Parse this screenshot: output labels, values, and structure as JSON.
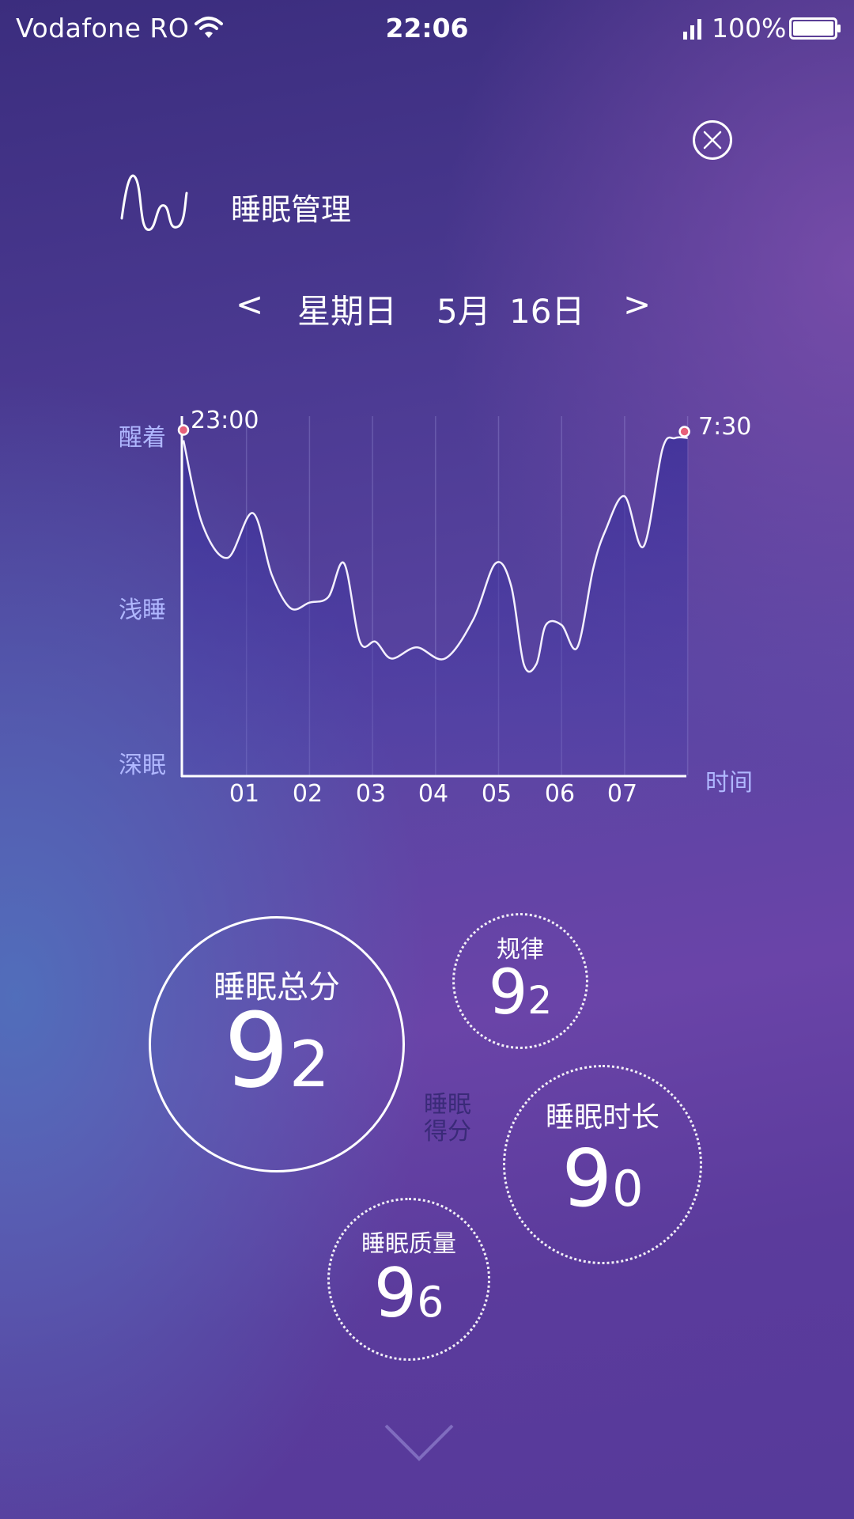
{
  "status_bar": {
    "carrier": "Vodafone RO",
    "time": "22:06",
    "battery": "100%",
    "battery_level": 1.0,
    "icons": [
      "wifi-icon",
      "signal-icon",
      "battery-icon"
    ]
  },
  "header": {
    "title": "睡眠管理",
    "icons": [
      "sleep-wave-logo-icon",
      "close-icon"
    ]
  },
  "date_nav": {
    "prev_label": "<",
    "weekday": "星期日",
    "month": "5月",
    "day": "16日",
    "next_label": ">"
  },
  "chart_data": {
    "type": "area",
    "y_levels": [
      "醒着",
      "浅睡",
      "深眠"
    ],
    "x_label": "时间",
    "x_ticks": [
      "01",
      "02",
      "03",
      "04",
      "05",
      "06",
      "07"
    ],
    "start_time": "23:00",
    "end_time": "7:30",
    "grid": true,
    "series": [
      {
        "x": [
          0,
          0.3,
          0.7,
          1.1,
          1.4,
          1.7,
          2.0,
          2.3,
          2.55,
          2.8,
          3.05,
          3.3,
          3.7,
          4.15,
          4.6,
          4.95,
          5.2,
          5.4,
          5.6,
          5.75,
          6.0,
          6.25,
          6.5,
          6.7,
          7.0,
          7.3,
          7.6,
          7.8,
          8.0
        ],
        "y": [
          3.0,
          2.25,
          1.95,
          2.35,
          1.8,
          1.5,
          1.55,
          1.6,
          1.9,
          1.2,
          1.2,
          1.05,
          1.15,
          1.05,
          1.4,
          1.9,
          1.7,
          1.0,
          1.0,
          1.35,
          1.35,
          1.15,
          1.85,
          2.2,
          2.5,
          2.05,
          2.92,
          3.02,
          3.02
        ]
      }
    ],
    "y_range": [
      0,
      3
    ]
  },
  "scores": {
    "caption": "睡眠得分",
    "total": {
      "label": "睡眠总分",
      "tens": "9",
      "ones": "2"
    },
    "regularity": {
      "label": "规律",
      "tens": "9",
      "ones": "2"
    },
    "duration": {
      "label": "睡眠时长",
      "tens": "9",
      "ones": "0"
    },
    "quality": {
      "label": "睡眠质量",
      "tens": "9",
      "ones": "6"
    }
  },
  "footer": {
    "icons": [
      "chevron-down-icon"
    ]
  },
  "colors": {
    "accent_point": "#e8607a",
    "axis_label": "#b0b7ff",
    "caption": "#3a2a78"
  }
}
